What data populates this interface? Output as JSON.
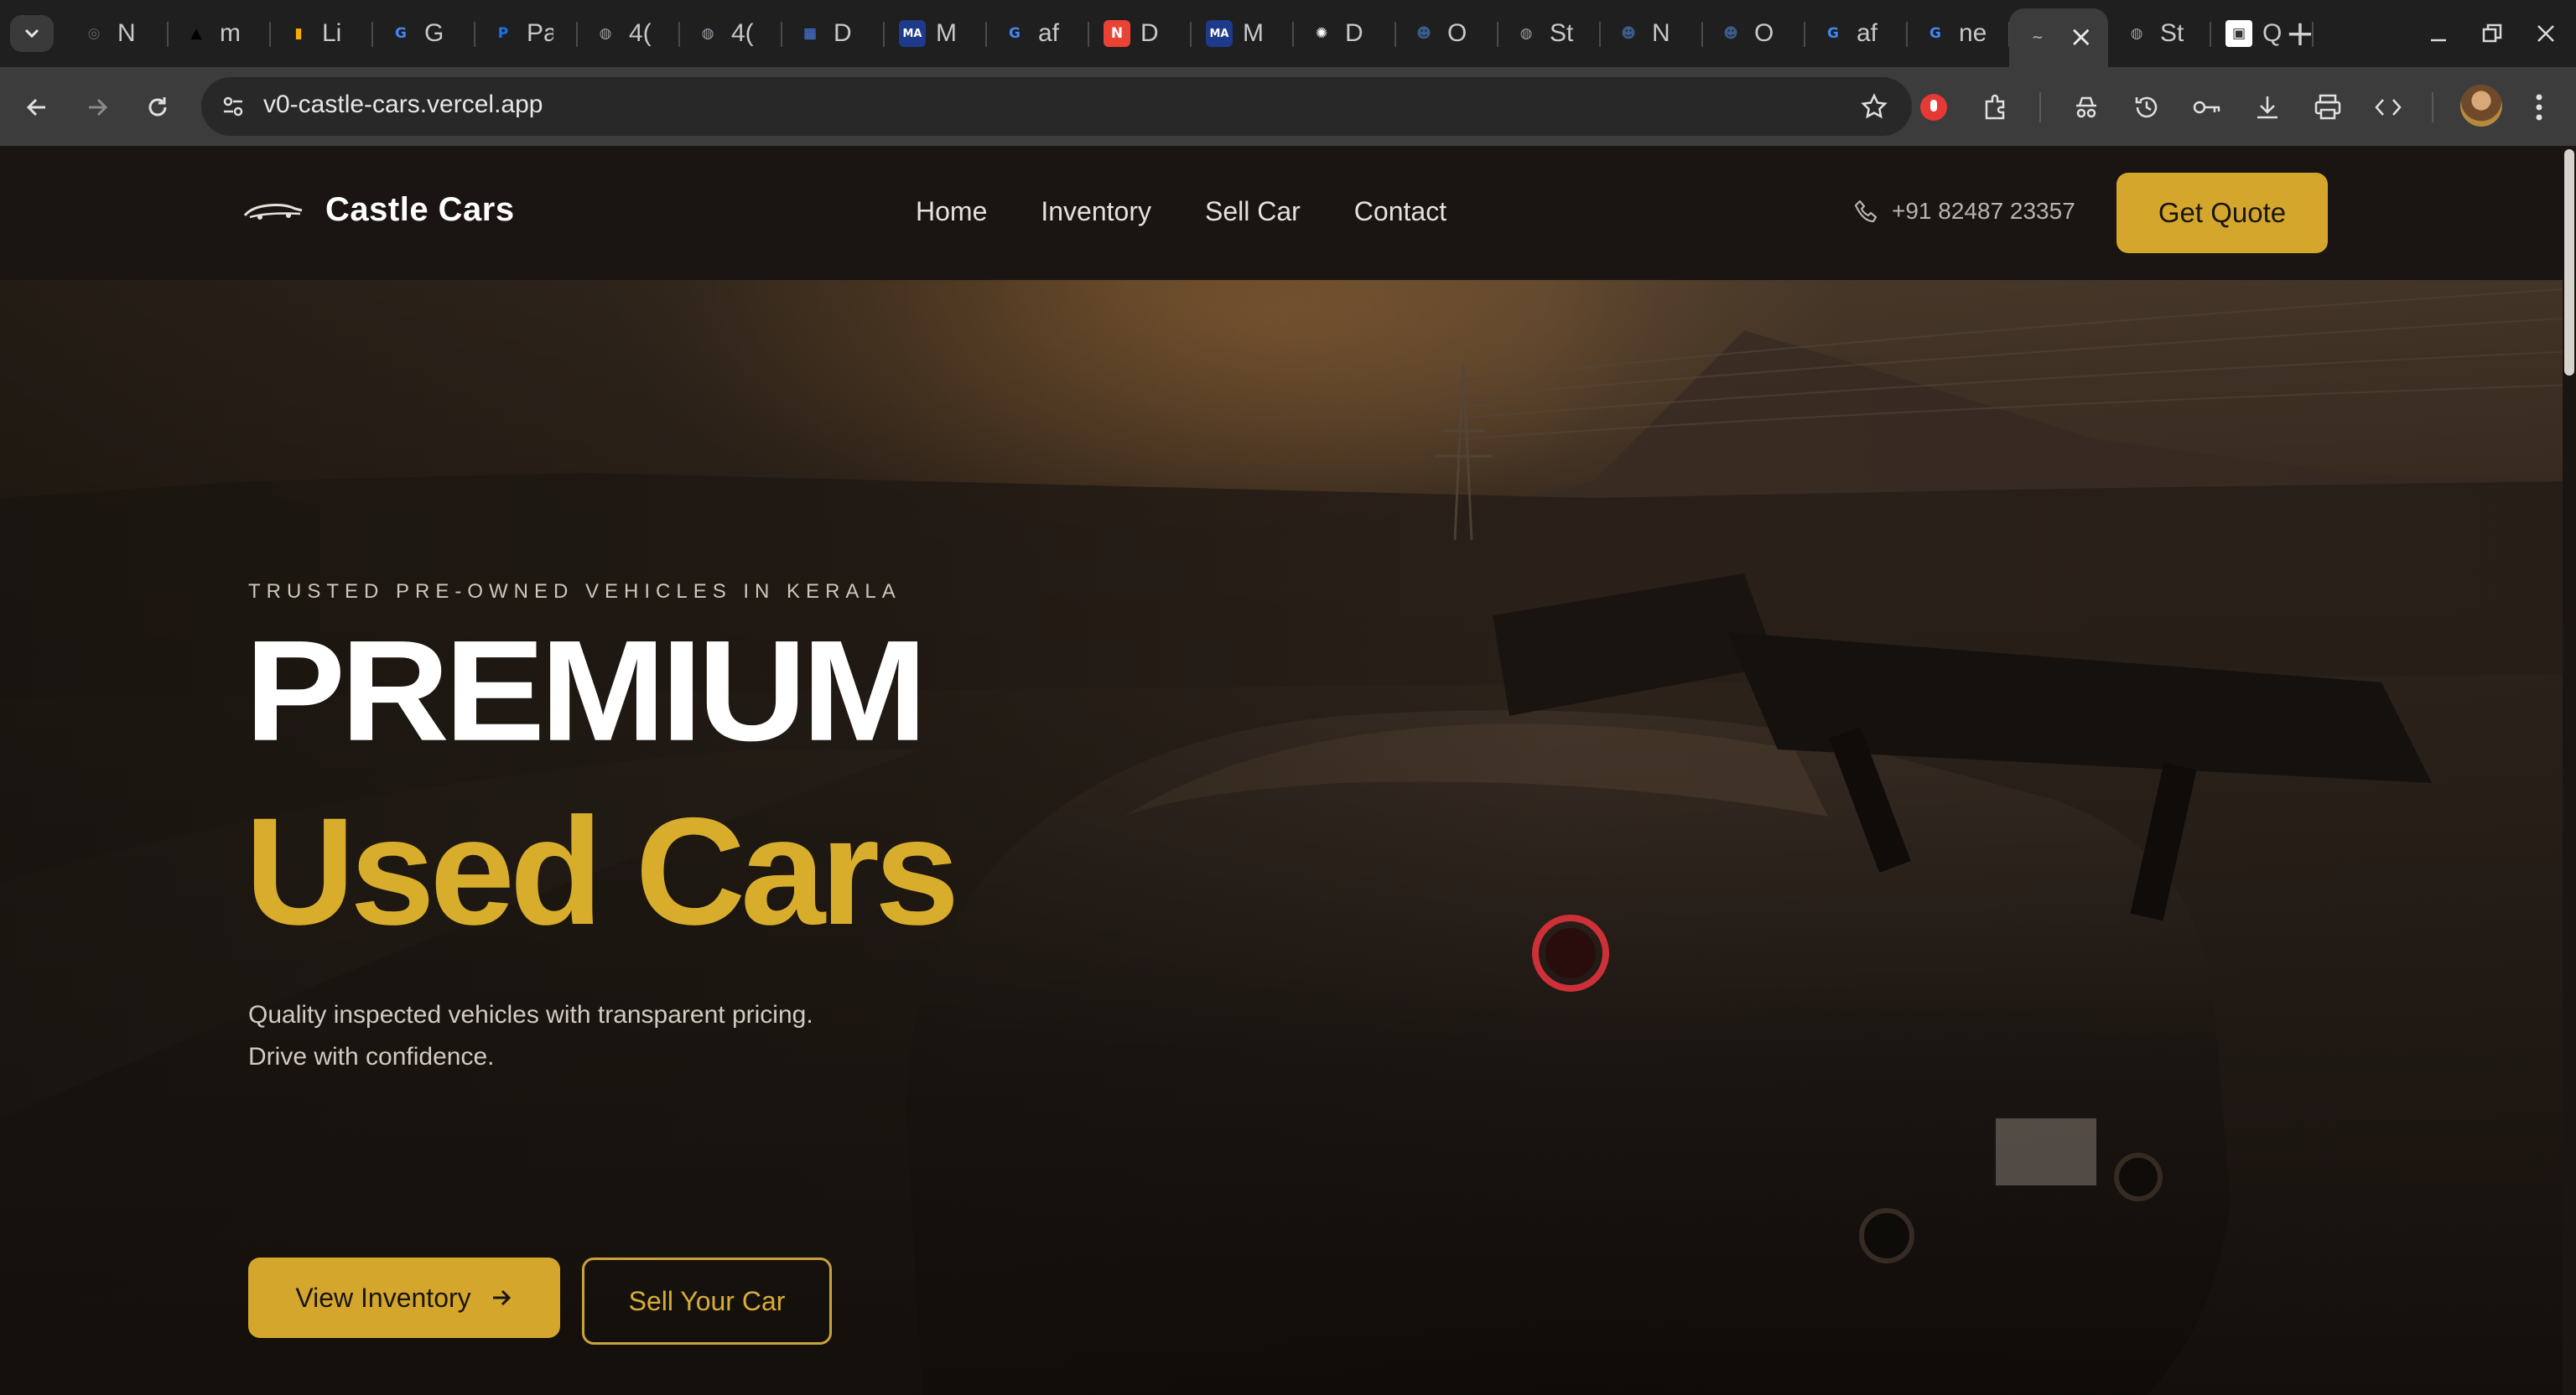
{
  "browser": {
    "tabs": [
      {
        "title": "N",
        "icon": "chrome-icon",
        "color": "#5f6368"
      },
      {
        "title": "m",
        "icon": "triangle-icon",
        "color": "#000000"
      },
      {
        "title": "Li",
        "icon": "analytics-icon",
        "color": "#f9ab00"
      },
      {
        "title": "G",
        "icon": "google-icon",
        "color": "#4285f4"
      },
      {
        "title": "Pa",
        "icon": "pa-icon",
        "color": "#1a73e8"
      },
      {
        "title": "4(",
        "icon": "globe-icon",
        "color": "#9aa0a6"
      },
      {
        "title": "4(",
        "icon": "globe-icon",
        "color": "#9aa0a6"
      },
      {
        "title": "D",
        "icon": "grid-icon",
        "color": "#4c7ef3"
      },
      {
        "title": "M",
        "icon": "ma-icon",
        "color": "#1e3a8a"
      },
      {
        "title": "af",
        "icon": "google-icon",
        "color": "#4285f4"
      },
      {
        "title": "D",
        "icon": "d-icon",
        "color": "#ea4335"
      },
      {
        "title": "M",
        "icon": "ma-icon",
        "color": "#1e3a8a"
      },
      {
        "title": "D",
        "icon": "openai-icon",
        "color": "#ffffff"
      },
      {
        "title": "O",
        "icon": "robot-icon",
        "color": "#3b5b8a"
      },
      {
        "title": "St",
        "icon": "globe-icon",
        "color": "#9aa0a6"
      },
      {
        "title": "N",
        "icon": "robot-icon",
        "color": "#3b5b8a"
      },
      {
        "title": "O",
        "icon": "robot-icon",
        "color": "#3b5b8a"
      },
      {
        "title": "af",
        "icon": "google-icon",
        "color": "#4285f4"
      },
      {
        "title": "ne",
        "icon": "google-icon",
        "color": "#4285f4"
      },
      {
        "title": "",
        "icon": "car-icon",
        "color": "#9aa0a6",
        "active": true
      },
      {
        "title": "St",
        "icon": "globe-icon",
        "color": "#9aa0a6"
      },
      {
        "title": "Q",
        "icon": "q-icon",
        "color": "#ffffff"
      }
    ],
    "url": "v0-castle-cars.vercel.app"
  },
  "site": {
    "brand": "Castle Cars",
    "nav": [
      "Home",
      "Inventory",
      "Sell Car",
      "Contact"
    ],
    "phone": "+91 82487 23357",
    "cta": "Get Quote"
  },
  "hero": {
    "eyebrow": "TRUSTED PRE-OWNED VEHICLES IN KERALA",
    "headline_1": "PREMIUM",
    "headline_2": "Used Cars",
    "subtitle_1": "Quality inspected vehicles with transparent pricing.",
    "subtitle_2": "Drive with confidence.",
    "primary_button": "View Inventory",
    "secondary_button": "Sell Your Car"
  },
  "colors": {
    "accent": "#d4a72c",
    "accent_text": "#d9ad2c",
    "header_bg": "#1a1613"
  }
}
